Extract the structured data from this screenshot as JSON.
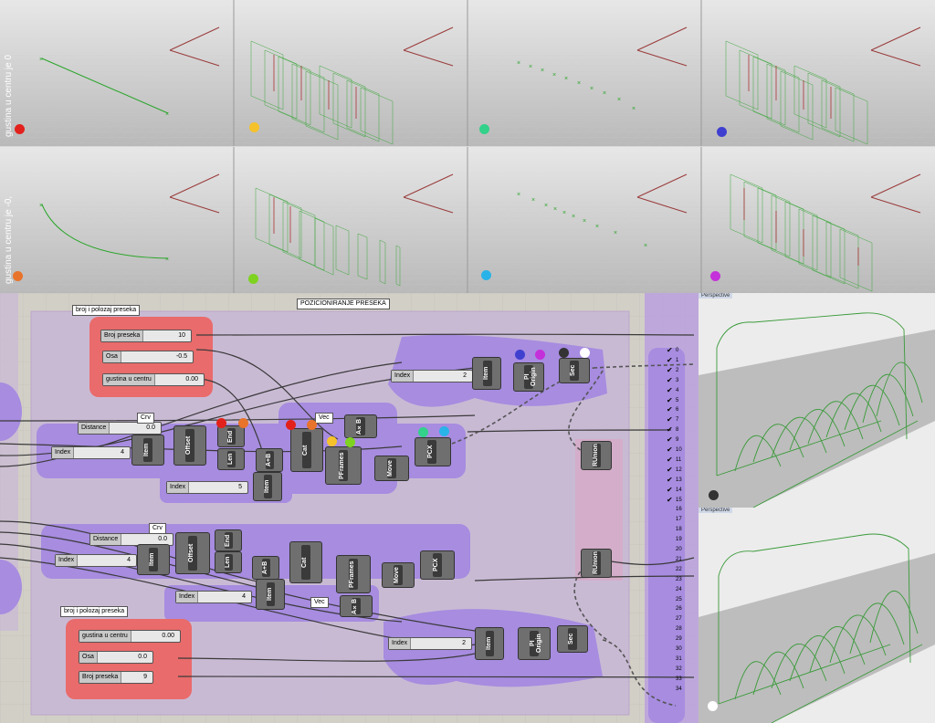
{
  "viewports": {
    "row1_label": "gustina u centru je 0",
    "row2_label": "gustina u centru je -0,",
    "row1_dots": [
      "#e3211c",
      "#f5c22b",
      "#33d18a",
      "#4040d0"
    ],
    "row2_dots": [
      "#e8732a",
      "#7ed321",
      "#2ab3e8",
      "#c430d9"
    ]
  },
  "canvas": {
    "group_title": "POZICIONIRANJE PRESEKA",
    "top_group_label": "broj i polozaj preseka",
    "bottom_group_label": "broj i polozaj preseka",
    "sliders_top": [
      {
        "label": "Broj preseka",
        "value": "10"
      },
      {
        "label": "Osa",
        "value": "-0.5"
      },
      {
        "label": "gustina u centru",
        "value": "0.00"
      }
    ],
    "sliders_bottom": [
      {
        "label": "gustina u centru",
        "value": "0.00"
      },
      {
        "label": "Osa",
        "value": "0.0"
      },
      {
        "label": "Broj preseka",
        "value": "9"
      }
    ],
    "index_top": "2",
    "index_mid1": "4",
    "index_mid2": "5",
    "index_lower1": "4",
    "index_lower2": "4",
    "index_bottom": "2",
    "distance_top": "0.0",
    "distance_bottom": "0.0",
    "tags": {
      "crv": "Crv",
      "vec": "Vec",
      "crv2": "Crv",
      "vec2": "Vec"
    },
    "components": {
      "item": "Item",
      "offset": "Offset",
      "len": "Len",
      "end": "End",
      "ab": "A+B",
      "cat": "Cat",
      "pframes": "PFrames",
      "move": "Move",
      "pcx": "PCX",
      "plorigin": "Pl Origin",
      "sec": "Sec",
      "runion": "RUnion",
      "axb": "A×B"
    },
    "list_numbers": [
      "0",
      "1",
      "2",
      "3",
      "4",
      "5",
      "6",
      "7",
      "8",
      "9",
      "10",
      "11",
      "12",
      "13",
      "14",
      "15",
      "16",
      "17",
      "18",
      "19",
      "20",
      "21",
      "22",
      "23",
      "24",
      "25",
      "26",
      "27",
      "28",
      "29",
      "30",
      "31",
      "32",
      "33",
      "34"
    ],
    "checked_count": 16
  },
  "right_views": {
    "top_title": "Perspective",
    "bottom_title": "Perspective"
  },
  "colors": {
    "group_purple": "#a78ce0",
    "group_red": "#e96b6b",
    "canvas_bg": "#d2cfc7",
    "wire": "#3a3a3a"
  }
}
